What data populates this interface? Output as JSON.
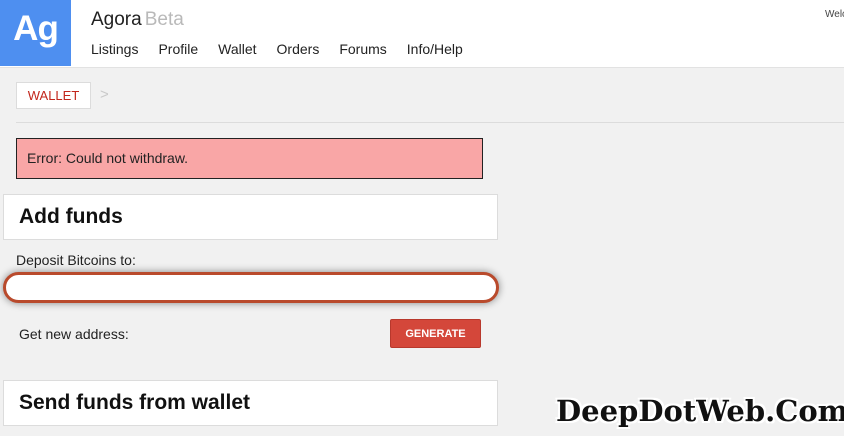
{
  "header": {
    "logo": "Ag",
    "title": "Agora",
    "beta": "Beta",
    "welcome": "Welcome",
    "nav": [
      "Listings",
      "Profile",
      "Wallet",
      "Orders",
      "Forums",
      "Info/Help"
    ]
  },
  "breadcrumb": {
    "current": "WALLET",
    "separator": ">"
  },
  "error": {
    "message": "Error: Could not withdraw."
  },
  "add_funds": {
    "title": "Add funds",
    "deposit_label": "Deposit Bitcoins to:",
    "deposit_value": "",
    "get_new_address_label": "Get new address:",
    "generate_label": "GENERATE"
  },
  "send_funds": {
    "title": "Send funds from wallet"
  },
  "watermark": "DeepDotWeb.Com",
  "colors": {
    "logo_bg": "#4e8ff0",
    "error_bg": "#f9a6a6",
    "generate_bg": "#d4473a",
    "breadcrumb_text": "#c2261c"
  }
}
